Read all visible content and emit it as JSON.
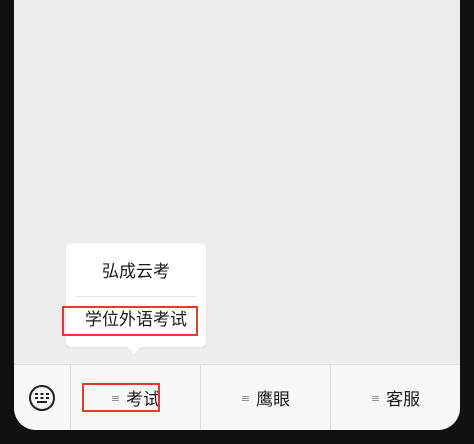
{
  "popup": {
    "items": [
      {
        "label": "弘成云考"
      },
      {
        "label": "学位外语考试"
      }
    ]
  },
  "menu_bar": {
    "keyboard_icon": "keyboard-icon",
    "tabs": [
      {
        "label": "考试",
        "icon": "menu-lines-icon"
      },
      {
        "label": "鹰眼",
        "icon": "menu-lines-icon"
      },
      {
        "label": "客服",
        "icon": "menu-lines-icon"
      }
    ]
  },
  "colors": {
    "highlight": "#d9412c",
    "screen_bg": "#ededed",
    "menu_bg": "#f7f7f7"
  }
}
